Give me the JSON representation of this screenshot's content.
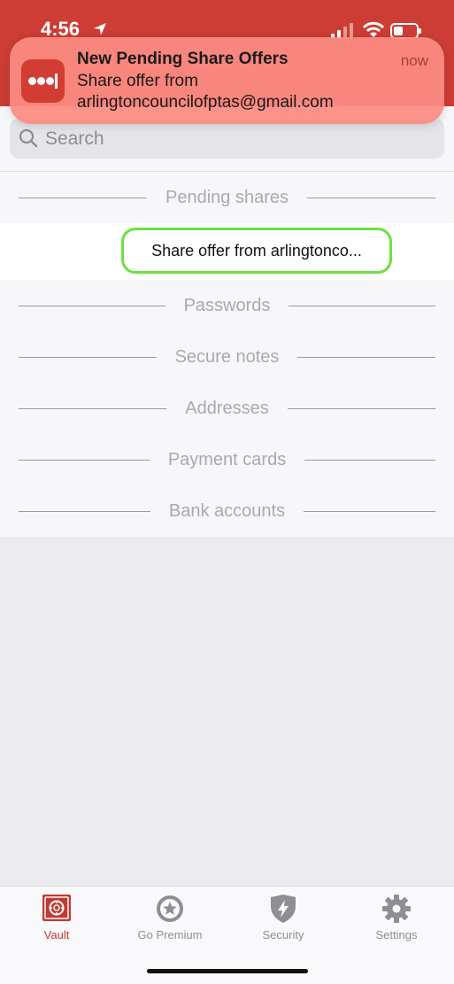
{
  "status_bar": {
    "time": "4:56"
  },
  "notification": {
    "title": "New Pending Share Offers",
    "body_line1": "Share offer from",
    "body_line2": "arlingtoncouncilofptas@gmail.com",
    "time": "now",
    "app_icon": "lastpass-dots-icon"
  },
  "search": {
    "placeholder": "Search",
    "value": ""
  },
  "sections": {
    "pending": "Pending shares",
    "passwords": "Passwords",
    "secure_notes": "Secure notes",
    "addresses": "Addresses",
    "payment_cards": "Payment cards",
    "bank_accounts": "Bank accounts"
  },
  "pending_item": {
    "label": "Share offer from arlingtonco..."
  },
  "tabs": [
    {
      "label": "Vault",
      "icon": "vault-icon",
      "active": true
    },
    {
      "label": "Go Premium",
      "icon": "star-icon",
      "active": false
    },
    {
      "label": "Security",
      "icon": "shield-bolt-icon",
      "active": false
    },
    {
      "label": "Settings",
      "icon": "gear-icon",
      "active": false
    }
  ],
  "colors": {
    "brand_red": "#cd3d35",
    "highlight_green": "#6ee040",
    "tab_active": "#c23a33"
  }
}
